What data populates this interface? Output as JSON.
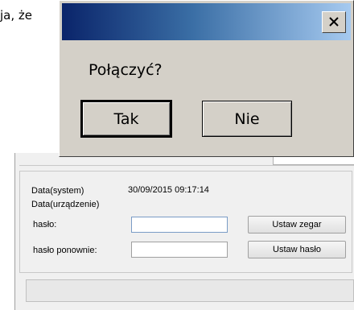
{
  "background": {
    "partial_text": "ja, że",
    "date_system_label": "Data(system)",
    "date_system_value": "30/09/2015 09:17:14",
    "date_device_label": "Data(urządzenie)",
    "password_label": "hasło:",
    "password_repeat_label": "hasło ponownie:",
    "set_clock_button": "Ustaw zegar",
    "set_password_button": "Ustaw hasło"
  },
  "dialog": {
    "message": "Połączyć?",
    "yes_label": "Tak",
    "no_label": "Nie",
    "close_icon": "close-icon"
  }
}
